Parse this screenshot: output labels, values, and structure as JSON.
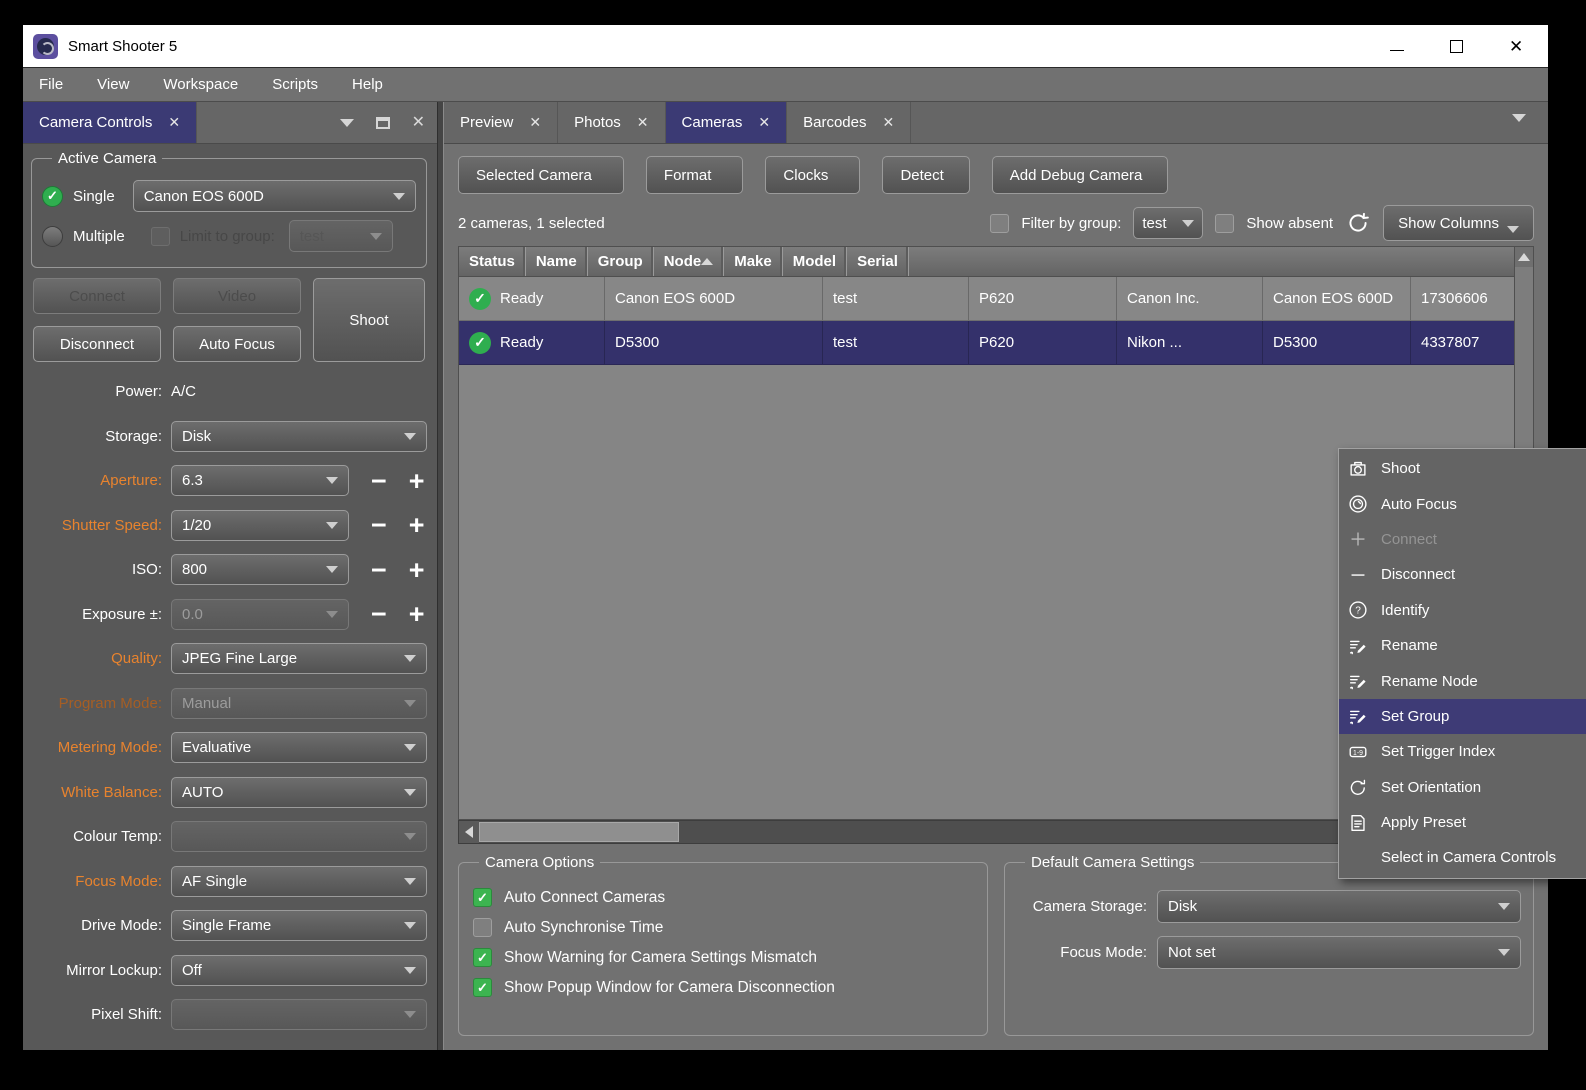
{
  "window": {
    "title": "Smart Shooter 5"
  },
  "menu_bar": {
    "items": [
      "File",
      "View",
      "Workspace",
      "Scripts",
      "Help"
    ]
  },
  "left_dock": {
    "tab_label": "Camera Controls",
    "tab_close": "✕",
    "active_camera": {
      "legend": "Active Camera",
      "single_label": "Single",
      "single_value": "Canon EOS 600D",
      "multiple_label": "Multiple",
      "limit_label": "Limit to group:",
      "limit_value": "test"
    },
    "buttons": {
      "connect": "Connect",
      "video": "Video",
      "shoot": "Shoot",
      "disconnect": "Disconnect",
      "auto_focus": "Auto Focus"
    },
    "settings": [
      {
        "label": "Power:",
        "value": "A/C",
        "type": "text"
      },
      {
        "label": "Storage:",
        "value": "Disk",
        "type": "select"
      },
      {
        "label": "Aperture:",
        "value": "6.3",
        "type": "select-stepper",
        "accent": true
      },
      {
        "label": "Shutter Speed:",
        "value": "1/20",
        "type": "select-stepper",
        "accent": true
      },
      {
        "label": "ISO:",
        "value": "800",
        "type": "select-stepper"
      },
      {
        "label": "Exposure ±:",
        "value": "0.0",
        "type": "select-stepper",
        "disabled": true
      },
      {
        "label": "Quality:",
        "value": "JPEG Fine Large",
        "type": "select",
        "accent": true
      },
      {
        "label": "Program Mode:",
        "value": "Manual",
        "type": "select",
        "accent": true,
        "disabled": true
      },
      {
        "label": "Metering Mode:",
        "value": "Evaluative",
        "type": "select",
        "accent": true
      },
      {
        "label": "White Balance:",
        "value": "AUTO",
        "type": "select",
        "accent": true
      },
      {
        "label": "Colour Temp:",
        "value": "",
        "type": "select",
        "disabled": true
      },
      {
        "label": "Focus Mode:",
        "value": "AF Single",
        "type": "select",
        "accent": true
      },
      {
        "label": "Drive Mode:",
        "value": "Single Frame",
        "type": "select"
      },
      {
        "label": "Mirror Lockup:",
        "value": "Off",
        "type": "select"
      },
      {
        "label": "Pixel Shift:",
        "value": "",
        "type": "select",
        "disabled": true
      }
    ]
  },
  "right_dock": {
    "tabs": [
      {
        "label": "Preview",
        "close": "✕"
      },
      {
        "label": "Photos",
        "close": "✕"
      },
      {
        "label": "Cameras",
        "close": "✕",
        "active": true
      },
      {
        "label": "Barcodes",
        "close": "✕"
      }
    ],
    "toolbar": [
      {
        "label": "Selected Camera",
        "dropdown": true
      },
      {
        "label": "Format",
        "dropdown": true
      },
      {
        "label": "Clocks",
        "dropdown": true
      },
      {
        "label": "Detect"
      },
      {
        "label": "Add Debug Camera"
      }
    ],
    "status_row": {
      "summary": "2 cameras, 1 selected",
      "filter_label": "Filter by group:",
      "filter_value": "test",
      "show_absent_label": "Show absent",
      "show_columns_label": "Show Columns"
    },
    "camera_table": {
      "columns": [
        {
          "label": "Status"
        },
        {
          "label": "Name"
        },
        {
          "label": "Group"
        },
        {
          "label": "Node",
          "sorted": true
        },
        {
          "label": "Make"
        },
        {
          "label": "Model"
        },
        {
          "label": "Serial"
        }
      ],
      "rows": [
        {
          "status": "Ready",
          "name": "Canon EOS 600D",
          "group": "test",
          "node": "P620",
          "make": "Canon Inc.",
          "model": "Canon EOS 600D",
          "serial": "17306606"
        },
        {
          "status": "Ready",
          "name": "D5300",
          "group": "test",
          "node": "P620",
          "make": "Nikon ...",
          "model": "D5300",
          "serial": "4337807",
          "selected": true
        }
      ]
    },
    "context_menu": {
      "items": [
        {
          "label": "Shoot",
          "icon": "camera"
        },
        {
          "label": "Auto Focus",
          "icon": "lens"
        },
        {
          "label": "Connect",
          "icon": "plus",
          "disabled": true
        },
        {
          "label": "Disconnect",
          "icon": "minus"
        },
        {
          "label": "Identify",
          "icon": "question"
        },
        {
          "label": "Rename",
          "icon": "edit"
        },
        {
          "label": "Rename Node",
          "icon": "edit"
        },
        {
          "label": "Set Group",
          "icon": "edit",
          "highlighted": true
        },
        {
          "label": "Set Trigger Index",
          "icon": "index"
        },
        {
          "label": "Set Orientation",
          "icon": "rotate",
          "submenu": true
        },
        {
          "label": "Apply Preset",
          "icon": "preset",
          "submenu": true
        },
        {
          "label": "Select in Camera Controls"
        }
      ]
    },
    "camera_options": {
      "legend": "Camera Options",
      "options": [
        {
          "label": "Auto Connect Cameras",
          "checked": true
        },
        {
          "label": "Auto Synchronise Time",
          "checked": false
        },
        {
          "label": "Show Warning for Camera Settings Mismatch",
          "checked": true
        },
        {
          "label": "Show Popup Window for Camera Disconnection",
          "checked": true
        }
      ]
    },
    "default_camera_settings": {
      "legend": "Default Camera Settings",
      "fields": [
        {
          "label": "Camera Storage:",
          "value": "Disk"
        },
        {
          "label": "Focus Mode:",
          "value": "Not set"
        }
      ]
    }
  },
  "colors": {
    "accent_orange": "#e8832e",
    "selection_purple": "#34316b",
    "tab_purple": "#3b3a74",
    "status_green": "#2fae4f"
  }
}
